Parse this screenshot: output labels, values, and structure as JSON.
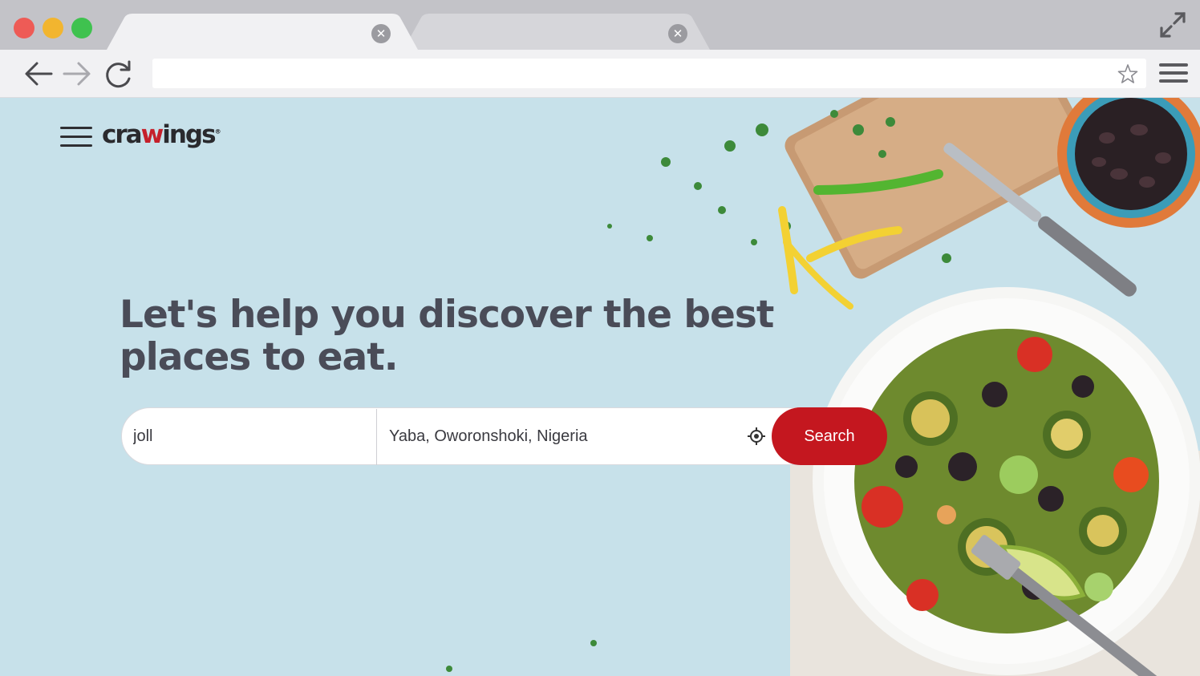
{
  "browser": {
    "tabs": [
      {
        "title": "",
        "active": true,
        "close_icon": "close-icon"
      },
      {
        "title": "",
        "active": false,
        "close_icon": "close-icon"
      }
    ],
    "address": {
      "value": ""
    },
    "colors": {
      "close": "#ee5b56",
      "minimize": "#f2b52f",
      "maximize": "#3fc24f"
    }
  },
  "site": {
    "logo": {
      "prefix": "cra",
      "mark": "w",
      "suffix": "ings",
      "trademark": "®"
    },
    "headline": "Let's help you discover the best places to eat.",
    "search": {
      "query": "joll",
      "location": "Yaba, Oworonshoki, Nigeria",
      "button_label": "Search"
    },
    "colors": {
      "accent": "#c4171f",
      "background": "#c7e1ea",
      "headline": "#4a4c58"
    }
  }
}
